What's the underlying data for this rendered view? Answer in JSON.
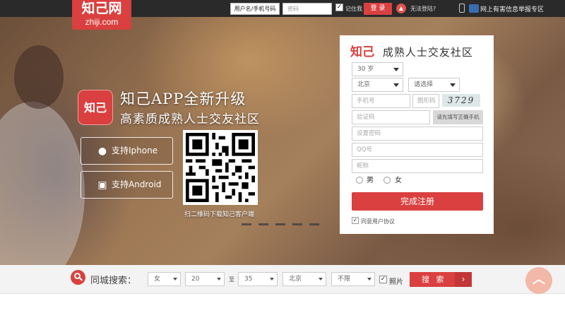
{
  "header": {
    "logo_cn": "知己网",
    "logo_en": "zhiji.com",
    "username_placeholder": "用户名/手机号码",
    "password_placeholder": "密码",
    "remember_label": "记住我",
    "login_label": "登 录",
    "cant_login_label": "无法登陆?",
    "report_label": "网上有害信息举报专区"
  },
  "hero": {
    "app_icon_text": "知己",
    "headline": "知己APP全新升级",
    "subline": "高素质成熟人士交友社区",
    "ios_button": "支持Iphone",
    "android_button": "支持Android",
    "qr_caption": "扫二维码下载知己客户端"
  },
  "register": {
    "logo": "知己",
    "slogan": "成熟人士交友社区",
    "age_value": "30 岁",
    "city_value": "北京",
    "district_value": "请选择",
    "phone_placeholder": "手机号",
    "captcha_placeholder": "图形码",
    "captcha_text": "3729",
    "sms_placeholder": "验证码",
    "verify_button": "请先填写正确手机",
    "password_placeholder": "设置密码",
    "qq_placeholder": "QQ号",
    "nickname_placeholder": "昵称",
    "gender_male": "男",
    "gender_female": "女",
    "submit_label": "完成注册",
    "agree_label": "同意用户协议"
  },
  "search": {
    "label": "同城搜索：",
    "gender_value": "女",
    "age_from": "20",
    "to_label": "至",
    "age_to": "35",
    "city_value": "北京",
    "extra_value": "不限",
    "photo_label": "照片",
    "button_label": "搜 索"
  },
  "colors": {
    "brand_red": "#d9403f",
    "topbar": "#2a2a2a"
  }
}
